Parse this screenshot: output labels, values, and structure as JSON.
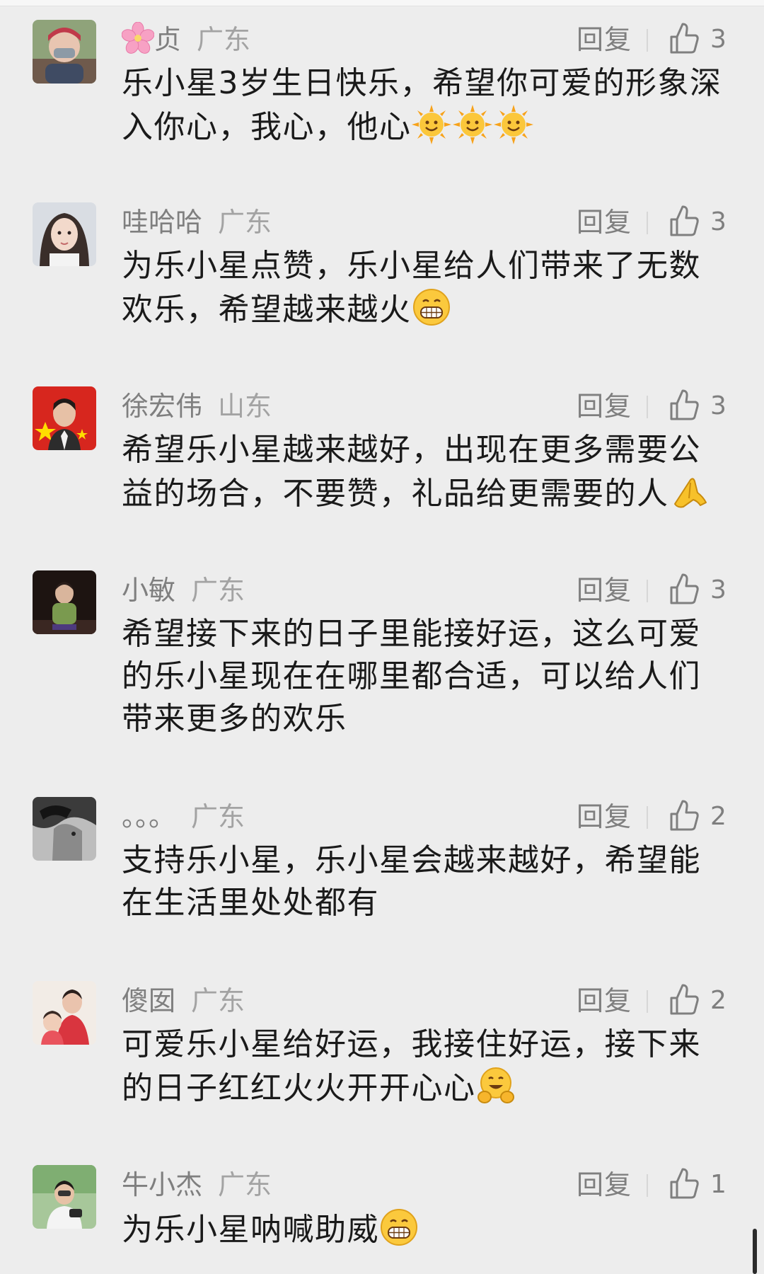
{
  "ui": {
    "reply_label": "回复",
    "colors": {
      "background": "#ededed",
      "meta_text": "#7f7f7f",
      "body_text": "#1a1a1a"
    }
  },
  "comments": [
    {
      "prefix_icon": "cherry-blossom-icon",
      "username": "贞",
      "region": "广东",
      "likes": "3",
      "text": "乐小星3岁生日快乐，希望你可爱的形象深入你心，我心，他心",
      "emojis": [
        "sun-face-icon",
        "sun-face-icon",
        "sun-face-icon"
      ]
    },
    {
      "username": "哇哈哈",
      "region": "广东",
      "likes": "3",
      "text": "为乐小星点赞，乐小星给人们带来了无数欢乐，希望越来越火",
      "emojis": [
        "grinning-face-icon"
      ]
    },
    {
      "username": "徐宏伟",
      "region": "山东",
      "likes": "3",
      "text": "希望乐小星越来越好，出现在更多需要公益的场合，不要赞，礼品给更需要的人",
      "emojis": [
        "praying-hands-icon"
      ]
    },
    {
      "username": "小敏",
      "region": "广东",
      "likes": "3",
      "text": "希望接下来的日子里能接好运，这么可爱的乐小星现在在哪里都合适，可以给人们带来更多的欢乐",
      "emojis": []
    },
    {
      "username": "。。。",
      "region": "广东",
      "likes": "2",
      "text": "支持乐小星，乐小星会越来越好，希望能在生活里处处都有",
      "emojis": []
    },
    {
      "username": "傻囡",
      "region": "广东",
      "likes": "2",
      "text": "可爱乐小星给好运，我接住好运，接下来的日子红红火火开开心心",
      "emojis": [
        "hugging-face-icon"
      ]
    },
    {
      "username": "牛小杰",
      "region": "广东",
      "likes": "1",
      "text": "为乐小星呐喊助威",
      "emojis": [
        "grinning-face-icon"
      ]
    }
  ]
}
